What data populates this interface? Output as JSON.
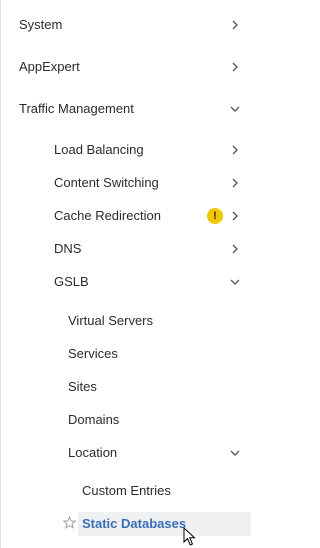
{
  "nav": {
    "system": "System",
    "appexpert": "AppExpert",
    "traffic_management": "Traffic Management",
    "load_balancing": "Load Balancing",
    "content_switching": "Content Switching",
    "cache_redirection": "Cache Redirection",
    "cache_warning": "!",
    "dns": "DNS",
    "gslb": "GSLB",
    "virtual_servers": "Virtual Servers",
    "services": "Services",
    "sites": "Sites",
    "domains": "Domains",
    "location": "Location",
    "custom_entries": "Custom Entries",
    "static_databases": "Static Databases"
  },
  "colors": {
    "selected_text": "#3a6fb5",
    "selected_bg": "#eef0f2",
    "warning": "#f2c700"
  }
}
